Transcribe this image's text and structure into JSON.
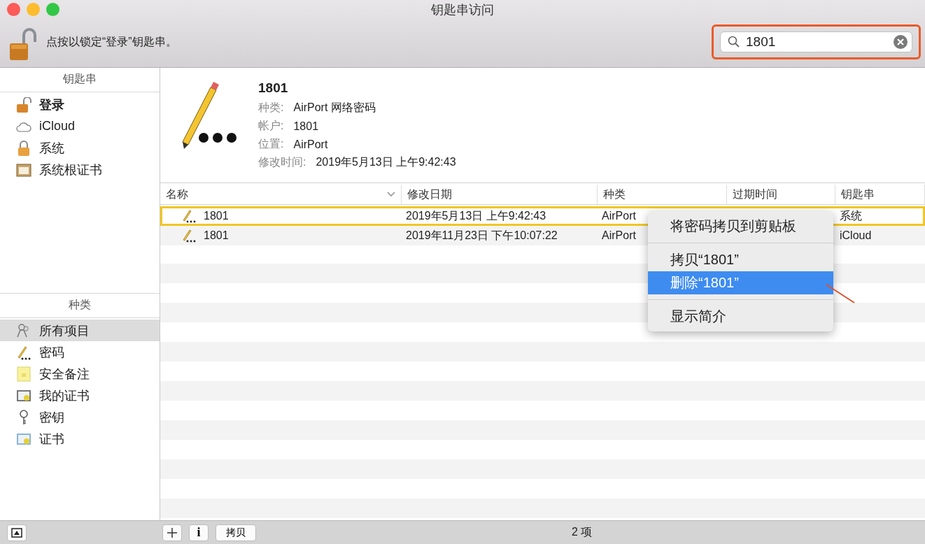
{
  "window": {
    "title": "钥匙串访问"
  },
  "toolbar": {
    "lock_text": "点按以锁定“登录”钥匙串。"
  },
  "search": {
    "value": "1801"
  },
  "sidebar": {
    "keychains_header": "钥匙串",
    "keychains": [
      {
        "label": "登录",
        "default": true,
        "kind": "unlocked"
      },
      {
        "label": "iCloud",
        "default": false,
        "kind": "cloud"
      },
      {
        "label": "系统",
        "default": false,
        "kind": "locked"
      },
      {
        "label": "系统根证书",
        "default": false,
        "kind": "roots"
      }
    ],
    "category_header": "种类",
    "categories": [
      {
        "label": "所有项目",
        "selected": true,
        "kind": "all"
      },
      {
        "label": "密码",
        "selected": false,
        "kind": "password"
      },
      {
        "label": "安全备注",
        "selected": false,
        "kind": "note"
      },
      {
        "label": "我的证书",
        "selected": false,
        "kind": "identity"
      },
      {
        "label": "密钥",
        "selected": false,
        "kind": "key"
      },
      {
        "label": "证书",
        "selected": false,
        "kind": "certificate"
      }
    ]
  },
  "detail": {
    "name": "1801",
    "fields": [
      {
        "label": "种类:",
        "value": "AirPort 网络密码"
      },
      {
        "label": "帐户:",
        "value": "1801"
      },
      {
        "label": "位置:",
        "value": "AirPort"
      },
      {
        "label": "修改时间:",
        "value": "2019年5月13日 上午9:42:43"
      }
    ]
  },
  "table": {
    "columns": [
      "名称",
      "修改日期",
      "种类",
      "过期时间",
      "钥匙串"
    ],
    "rows": [
      {
        "name": "1801",
        "modified": "2019年5月13日 上午9:42:43",
        "kind": "AirPort",
        "keychain": "系统",
        "selected": true
      },
      {
        "name": "1801",
        "modified": "2019年11月23日 下午10:07:22",
        "kind": "AirPort",
        "keychain": "iCloud",
        "selected": false
      }
    ]
  },
  "context_menu": {
    "groups": [
      [
        {
          "label": "将密码拷贝到剪贴板",
          "selected": false
        }
      ],
      [
        {
          "label": "拷贝“1801”",
          "selected": false
        },
        {
          "label": "删除“1801”",
          "selected": true
        }
      ],
      [
        {
          "label": "显示简介",
          "selected": false
        }
      ]
    ]
  },
  "footer": {
    "info_button": "i",
    "copy_button": "拷贝",
    "status": "2 项"
  }
}
